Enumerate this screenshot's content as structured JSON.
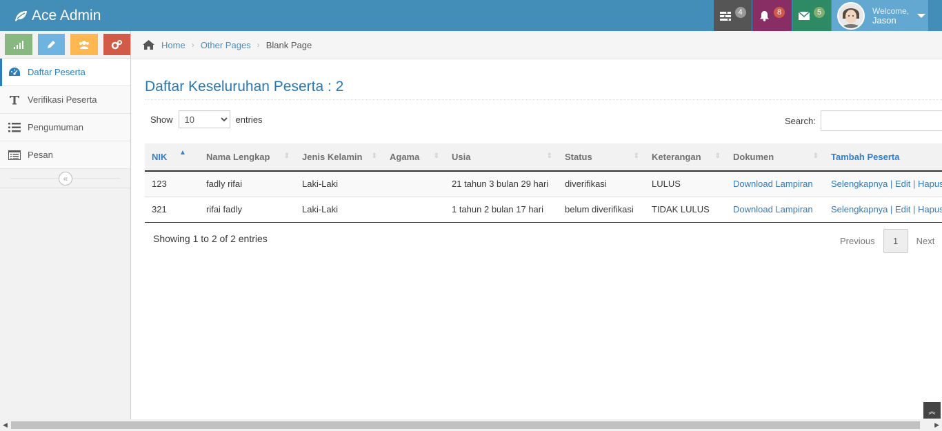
{
  "brand": {
    "name": "Ace Admin",
    "icon": "leaf-icon"
  },
  "topnav": {
    "tasks": {
      "icon": "tasks-icon",
      "count": "4"
    },
    "notifications": {
      "icon": "bell-icon",
      "count": "8"
    },
    "messages": {
      "icon": "envelope-icon",
      "count": "5"
    },
    "user": {
      "welcome": "Welcome,",
      "name": "Jason"
    }
  },
  "sidebar": {
    "shortcuts": [
      {
        "icon": "signal-icon",
        "color": "#87b87f"
      },
      {
        "icon": "pencil-icon",
        "color": "#6fb3e0"
      },
      {
        "icon": "users-icon",
        "color": "#ffb752"
      },
      {
        "icon": "cogs-icon",
        "color": "#d15b47"
      }
    ],
    "items": [
      {
        "label": "Daftar Peserta",
        "icon": "dashboard-icon",
        "active": true
      },
      {
        "label": "Verifikasi Peserta",
        "icon": "text-icon"
      },
      {
        "label": "Pengumuman",
        "icon": "list-icon"
      },
      {
        "label": "Pesan",
        "icon": "list-alt-icon"
      }
    ]
  },
  "breadcrumb": {
    "home": "Home",
    "level1": "Other Pages",
    "current": "Blank Page"
  },
  "page": {
    "title": "Daftar Keseluruhan Peserta : 2"
  },
  "table_controls": {
    "show_label": "Show",
    "page_size": "10",
    "entries_label": "entries",
    "search_label": "Search:",
    "search_value": ""
  },
  "table": {
    "headers": [
      "NIK",
      "Nama Lengkap",
      "Jenis Kelamin",
      "Agama",
      "Usia",
      "Status",
      "Keterangan",
      "Dokumen",
      "Tambah Peserta"
    ],
    "rows": [
      {
        "nik": "123",
        "nama": "fadly rifai",
        "jk": "Laki-Laki",
        "agama": "",
        "usia": "21 tahun 3 bulan 29 hari",
        "status": "diverifikasi",
        "ket": "LULUS",
        "dokumen": "Download Lampiran",
        "aksi": "Selengkapnya | Edit | Hapus"
      },
      {
        "nik": "321",
        "nama": "rifai fadly",
        "jk": "Laki-Laki",
        "agama": "",
        "usia": "1 tahun 2 bulan 17 hari",
        "status": "belum diverifikasi",
        "ket": "TIDAK LULUS",
        "dokumen": "Download Lampiran",
        "aksi": "Selengkapnya | Edit | Hapus"
      }
    ]
  },
  "footer": {
    "info": "Showing 1 to 2 of 2 entries",
    "prev": "Previous",
    "page": "1",
    "next": "Next"
  }
}
